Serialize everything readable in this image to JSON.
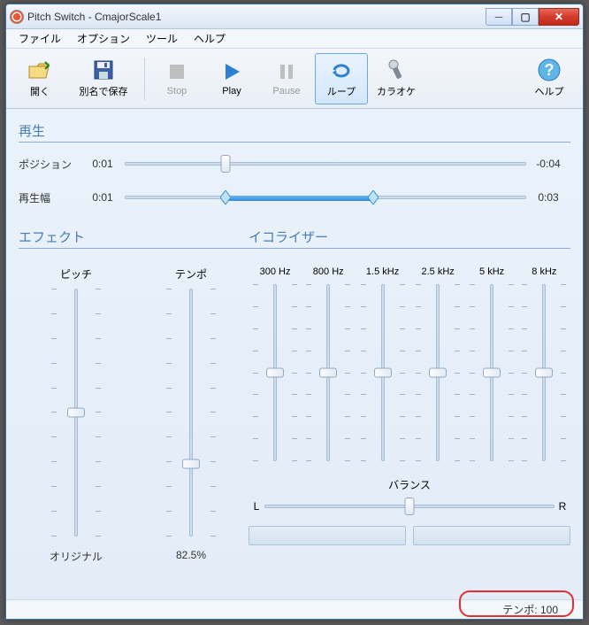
{
  "window": {
    "title": "Pitch Switch - CmajorScale1"
  },
  "menu": {
    "file": "ファイル",
    "options": "オプション",
    "tools": "ツール",
    "help": "ヘルプ"
  },
  "toolbar": {
    "open": "開く",
    "save_as": "別名で保存",
    "stop": "Stop",
    "play": "Play",
    "pause": "Pause",
    "loop": "ループ",
    "karaoke": "カラオケ",
    "help": "ヘルプ"
  },
  "playback": {
    "section": "再生",
    "position_label": "ポジション",
    "position_time": "0:01",
    "position_remaining": "-0:04",
    "position_percent": 25,
    "range_label": "再生幅",
    "range_start": "0:01",
    "range_end": "0:03",
    "range_from_percent": 25,
    "range_to_percent": 62
  },
  "effects": {
    "section": "エフェクト",
    "pitch": {
      "label": "ピッチ",
      "value": "オリジナル",
      "percent": 50
    },
    "tempo": {
      "label": "テンポ",
      "value": "82.5%",
      "percent": 71
    }
  },
  "equalizer": {
    "section": "イコライザー",
    "bands": [
      {
        "label": "300 Hz",
        "percent": 50
      },
      {
        "label": "800 Hz",
        "percent": 50
      },
      {
        "label": "1.5 kHz",
        "percent": 50
      },
      {
        "label": "2.5 kHz",
        "percent": 50
      },
      {
        "label": "5 kHz",
        "percent": 50
      },
      {
        "label": "8 kHz",
        "percent": 50
      }
    ],
    "balance": {
      "label": "バランス",
      "left": "L",
      "right": "R",
      "percent": 50
    }
  },
  "status": {
    "tempo_label": "テンポ:",
    "tempo_value": "100"
  }
}
